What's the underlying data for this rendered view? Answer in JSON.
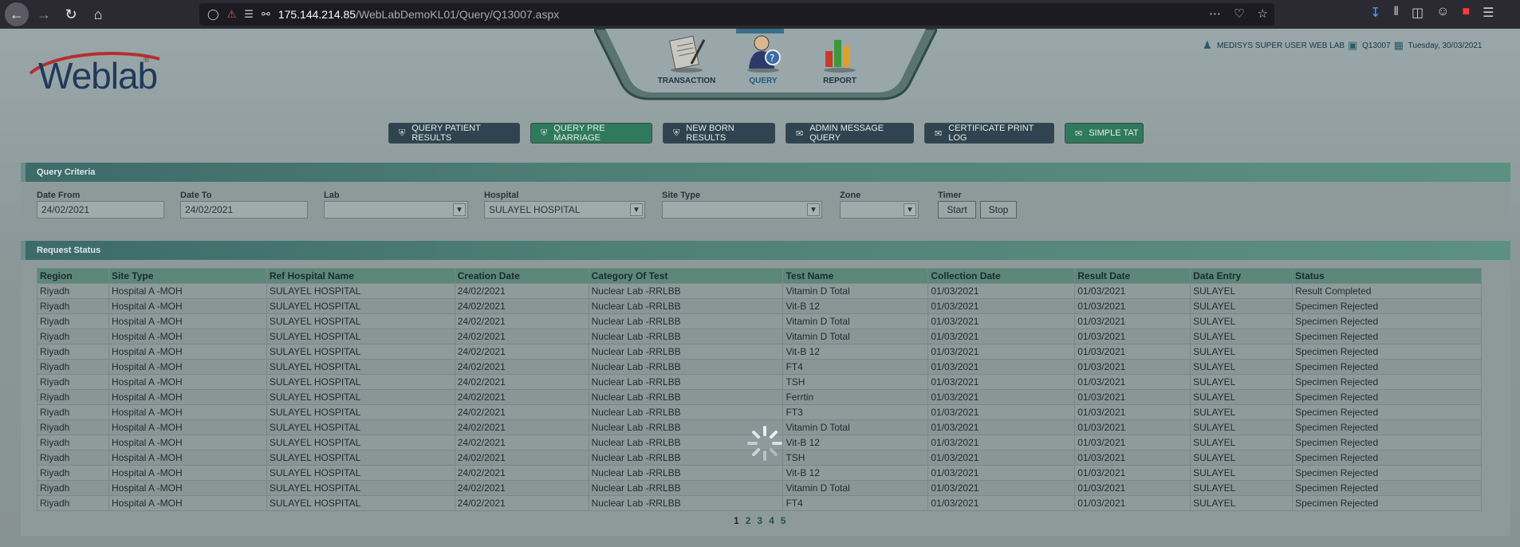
{
  "browser": {
    "url_host": "175.144.214.85",
    "url_path": "/WebLabDemoKL01/Query/Q13007.aspx"
  },
  "app": {
    "logo_text": "Weblab",
    "logo_reg": "®",
    "top_tabs": [
      {
        "label": "TRANSACTION"
      },
      {
        "label": "QUERY"
      },
      {
        "label": "REPORT"
      }
    ],
    "user": "MEDISYS SUPER USER WEB LAB",
    "screen_code": "Q13007",
    "date": "Tuesday, 30/03/2021"
  },
  "menu": [
    {
      "label": "QUERY PATIENT RESULTS",
      "style": "navy"
    },
    {
      "label": "QUERY PRE MARRIAGE",
      "style": "teal"
    },
    {
      "label": "NEW BORN RESULTS",
      "style": "navy"
    },
    {
      "label": "ADMIN MESSAGE QUERY",
      "style": "navy"
    },
    {
      "label": "CERTIFICATE PRINT LOG",
      "style": "navy"
    },
    {
      "label": "SIMPLE TAT",
      "style": "teal"
    }
  ],
  "criteria": {
    "title": "Query Criteria",
    "date_from_label": "Date From",
    "date_from": "24/02/2021",
    "date_to_label": "Date To",
    "date_to": "24/02/2021",
    "lab_label": "Lab",
    "lab_value": "",
    "hospital_label": "Hospital",
    "hospital_value": "SULAYEL HOSPITAL",
    "site_type_label": "Site Type",
    "site_type_value": "",
    "zone_label": "Zone",
    "zone_value": "",
    "timer_label": "Timer",
    "start_label": "Start",
    "stop_label": "Stop"
  },
  "status": {
    "title": "Request Status",
    "columns": [
      "Region",
      "Site Type",
      "Ref Hospital Name",
      "Creation Date",
      "Category Of Test",
      "Test Name",
      "Collection Date",
      "Result Date",
      "Data Entry",
      "Status"
    ],
    "rows": [
      [
        "Riyadh",
        "Hospital A -MOH",
        "SULAYEL HOSPITAL",
        "24/02/2021",
        "Nuclear Lab -RRLBB",
        "Vitamin D Total",
        "01/03/2021",
        "01/03/2021",
        "SULAYEL",
        "Result Completed"
      ],
      [
        "Riyadh",
        "Hospital A -MOH",
        "SULAYEL HOSPITAL",
        "24/02/2021",
        "Nuclear Lab -RRLBB",
        "Vit-B 12",
        "01/03/2021",
        "01/03/2021",
        "SULAYEL",
        "Specimen Rejected"
      ],
      [
        "Riyadh",
        "Hospital A -MOH",
        "SULAYEL HOSPITAL",
        "24/02/2021",
        "Nuclear Lab -RRLBB",
        "Vitamin D Total",
        "01/03/2021",
        "01/03/2021",
        "SULAYEL",
        "Specimen Rejected"
      ],
      [
        "Riyadh",
        "Hospital A -MOH",
        "SULAYEL HOSPITAL",
        "24/02/2021",
        "Nuclear Lab -RRLBB",
        "Vitamin D Total",
        "01/03/2021",
        "01/03/2021",
        "SULAYEL",
        "Specimen Rejected"
      ],
      [
        "Riyadh",
        "Hospital A -MOH",
        "SULAYEL HOSPITAL",
        "24/02/2021",
        "Nuclear Lab -RRLBB",
        "Vit-B 12",
        "01/03/2021",
        "01/03/2021",
        "SULAYEL",
        "Specimen Rejected"
      ],
      [
        "Riyadh",
        "Hospital A -MOH",
        "SULAYEL HOSPITAL",
        "24/02/2021",
        "Nuclear Lab -RRLBB",
        "FT4",
        "01/03/2021",
        "01/03/2021",
        "SULAYEL",
        "Specimen Rejected"
      ],
      [
        "Riyadh",
        "Hospital A -MOH",
        "SULAYEL HOSPITAL",
        "24/02/2021",
        "Nuclear Lab -RRLBB",
        "TSH",
        "01/03/2021",
        "01/03/2021",
        "SULAYEL",
        "Specimen Rejected"
      ],
      [
        "Riyadh",
        "Hospital A -MOH",
        "SULAYEL HOSPITAL",
        "24/02/2021",
        "Nuclear Lab -RRLBB",
        "Ferrtin",
        "01/03/2021",
        "01/03/2021",
        "SULAYEL",
        "Specimen Rejected"
      ],
      [
        "Riyadh",
        "Hospital A -MOH",
        "SULAYEL HOSPITAL",
        "24/02/2021",
        "Nuclear Lab -RRLBB",
        "FT3",
        "01/03/2021",
        "01/03/2021",
        "SULAYEL",
        "Specimen Rejected"
      ],
      [
        "Riyadh",
        "Hospital A -MOH",
        "SULAYEL HOSPITAL",
        "24/02/2021",
        "Nuclear Lab -RRLBB",
        "Vitamin D Total",
        "01/03/2021",
        "01/03/2021",
        "SULAYEL",
        "Specimen Rejected"
      ],
      [
        "Riyadh",
        "Hospital A -MOH",
        "SULAYEL HOSPITAL",
        "24/02/2021",
        "Nuclear Lab -RRLBB",
        "Vit-B 12",
        "01/03/2021",
        "01/03/2021",
        "SULAYEL",
        "Specimen Rejected"
      ],
      [
        "Riyadh",
        "Hospital A -MOH",
        "SULAYEL HOSPITAL",
        "24/02/2021",
        "Nuclear Lab -RRLBB",
        "TSH",
        "01/03/2021",
        "01/03/2021",
        "SULAYEL",
        "Specimen Rejected"
      ],
      [
        "Riyadh",
        "Hospital A -MOH",
        "SULAYEL HOSPITAL",
        "24/02/2021",
        "Nuclear Lab -RRLBB",
        "Vit-B 12",
        "01/03/2021",
        "01/03/2021",
        "SULAYEL",
        "Specimen Rejected"
      ],
      [
        "Riyadh",
        "Hospital A -MOH",
        "SULAYEL HOSPITAL",
        "24/02/2021",
        "Nuclear Lab -RRLBB",
        "Vitamin D Total",
        "01/03/2021",
        "01/03/2021",
        "SULAYEL",
        "Specimen Rejected"
      ],
      [
        "Riyadh",
        "Hospital A -MOH",
        "SULAYEL HOSPITAL",
        "24/02/2021",
        "Nuclear Lab -RRLBB",
        "FT4",
        "01/03/2021",
        "01/03/2021",
        "SULAYEL",
        "Specimen Rejected"
      ]
    ],
    "pages": [
      "1",
      "2",
      "3",
      "4",
      "5"
    ],
    "current_page": "1"
  },
  "colors": {
    "teal_button": "#2f7a5c",
    "navy_button": "#2f4450",
    "header_bar": "#4f8077"
  }
}
